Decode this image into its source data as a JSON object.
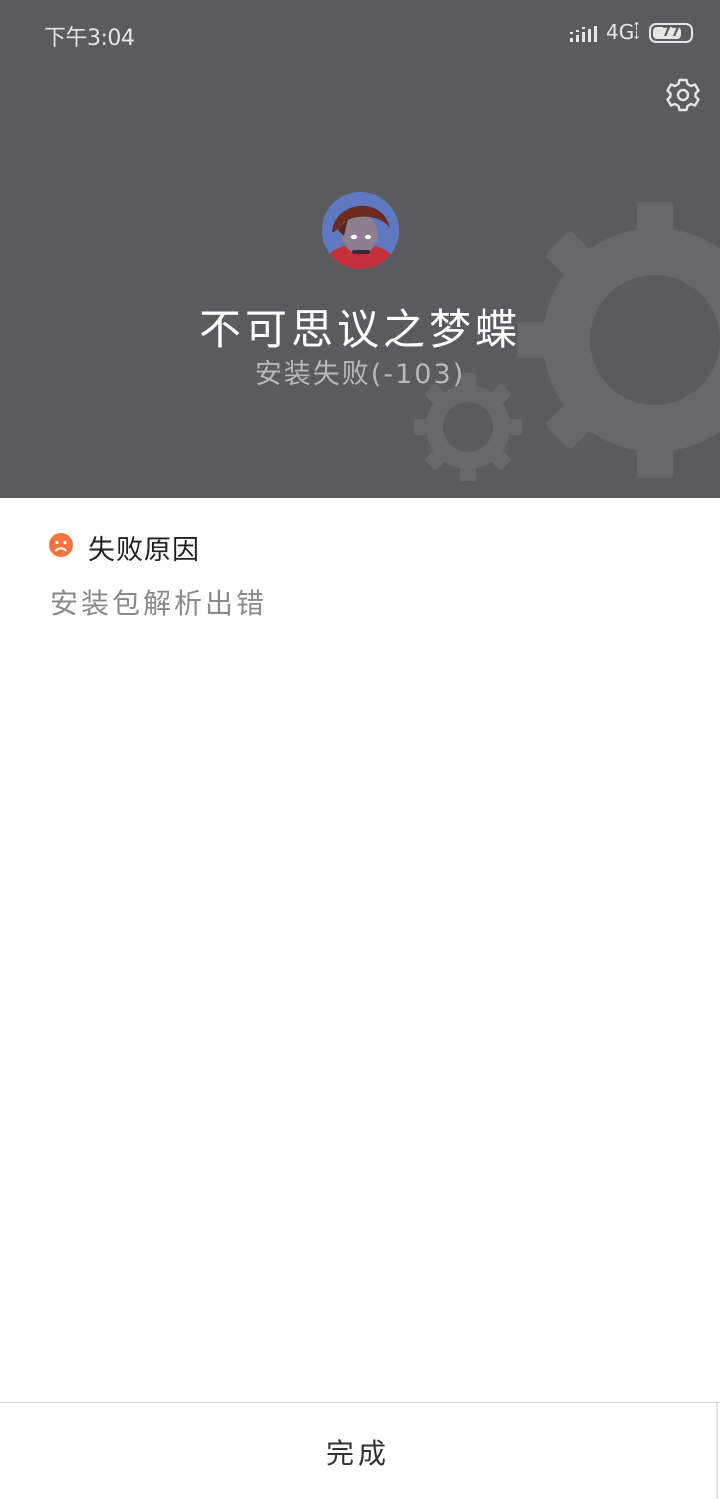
{
  "status_bar": {
    "time": "下午3:04",
    "network": "4G",
    "battery": "77",
    "battery_level": 0.77
  },
  "header": {
    "settings_icon": "gear-icon",
    "app_name": "不可思议之梦蝶",
    "install_status": "安装失败(-103)",
    "background_color": "#5a5a5f"
  },
  "failure": {
    "icon": "sad-face-icon",
    "title": "失败原因",
    "detail": "安装包解析出错",
    "accent_color": "#f5743e"
  },
  "footer": {
    "done_label": "完成"
  }
}
